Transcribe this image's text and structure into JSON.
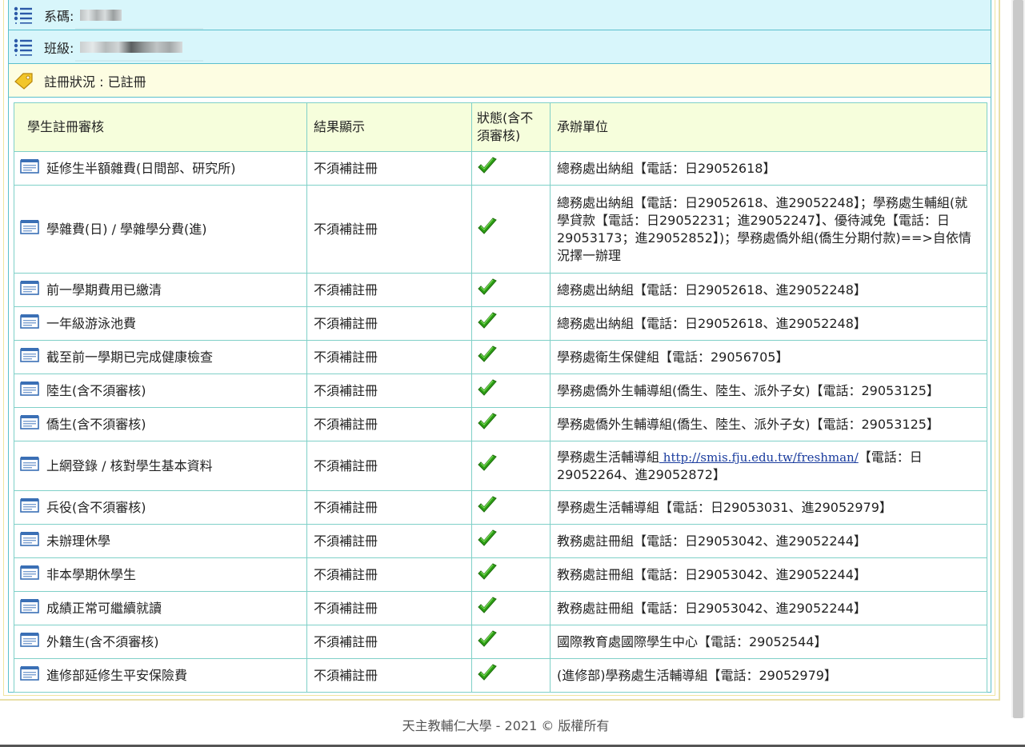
{
  "info": {
    "dept_label": "系碼:",
    "class_label": "班級:",
    "status_label": "註冊狀況 : 已註冊"
  },
  "table": {
    "headers": [
      "學生註冊審核",
      "結果顯示",
      "狀態(含不須審核)",
      "承辦單位"
    ],
    "header_status_line1": "狀態(含不",
    "header_status_line2": "須審核)",
    "rows": [
      {
        "item": "延修生半額雜費(日間部、研究所)",
        "result": "不須補註冊",
        "unit": "總務處出納組【電話：日29052618】"
      },
      {
        "item": "學雜費(日) / 學雜學分費(進)",
        "result": "不須補註冊",
        "unit": "總務處出納組【電話：日29052618、進29052248】；學務處生輔組(就學貸款【電話：日29052231；進29052247】、優待減免【電話：日29053173；進29052852】)；學務處僑外組(僑生分期付款)==>自依情況擇一辦理"
      },
      {
        "item": "前一學期費用已繳清",
        "result": "不須補註冊",
        "unit": "總務處出納組【電話：日29052618、進29052248】"
      },
      {
        "item": "一年級游泳池費",
        "result": "不須補註冊",
        "unit": "總務處出納組【電話：日29052618、進29052248】"
      },
      {
        "item": "截至前一學期已完成健康檢查",
        "result": "不須補註冊",
        "unit": "學務處衛生保健組【電話：29056705】"
      },
      {
        "item": "陸生(含不須審核)",
        "result": "不須補註冊",
        "unit": "學務處僑外生輔導組(僑生、陸生、派外子女)【電話：29053125】"
      },
      {
        "item": "僑生(含不須審核)",
        "result": "不須補註冊",
        "unit": "學務處僑外生輔導組(僑生、陸生、派外子女)【電話：29053125】"
      },
      {
        "item": "上網登錄 / 核對學生基本資料",
        "result": "不須補註冊",
        "unit_pre": "學務處生活輔導組",
        "unit_link": " http://smis.fju.edu.tw/freshman/",
        "unit_post": "【電話：日29052264、進29052872】"
      },
      {
        "item": "兵役(含不須審核)",
        "result": "不須補註冊",
        "unit": "學務處生活輔導組【電話：日29053031、進29052979】"
      },
      {
        "item": "未辦理休學",
        "result": "不須補註冊",
        "unit": "教務處註冊組【電話：日29053042、進29052244】"
      },
      {
        "item": "非本學期休學生",
        "result": "不須補註冊",
        "unit": "教務處註冊組【電話：日29053042、進29052244】"
      },
      {
        "item": "成績正常可繼續就讀",
        "result": "不須補註冊",
        "unit": "教務處註冊組【電話：日29053042、進29052244】"
      },
      {
        "item": "外籍生(含不須審核)",
        "result": "不須補註冊",
        "unit": "國際教育處國際學生中心【電話：29052544】"
      },
      {
        "item": "進修部延修生平安保險費",
        "result": "不須補註冊",
        "unit": "(進修部)學務處生活輔導組【電話：29052979】"
      }
    ]
  },
  "footer": "天主教輔仁大學 - 2021 © 版權所有",
  "colors": {
    "info_bg": "#d8f6fb",
    "status_bg": "#fdfde2",
    "header_bg": "#f6fedc",
    "border": "#7fd0c8",
    "check": "#2e9e16"
  }
}
